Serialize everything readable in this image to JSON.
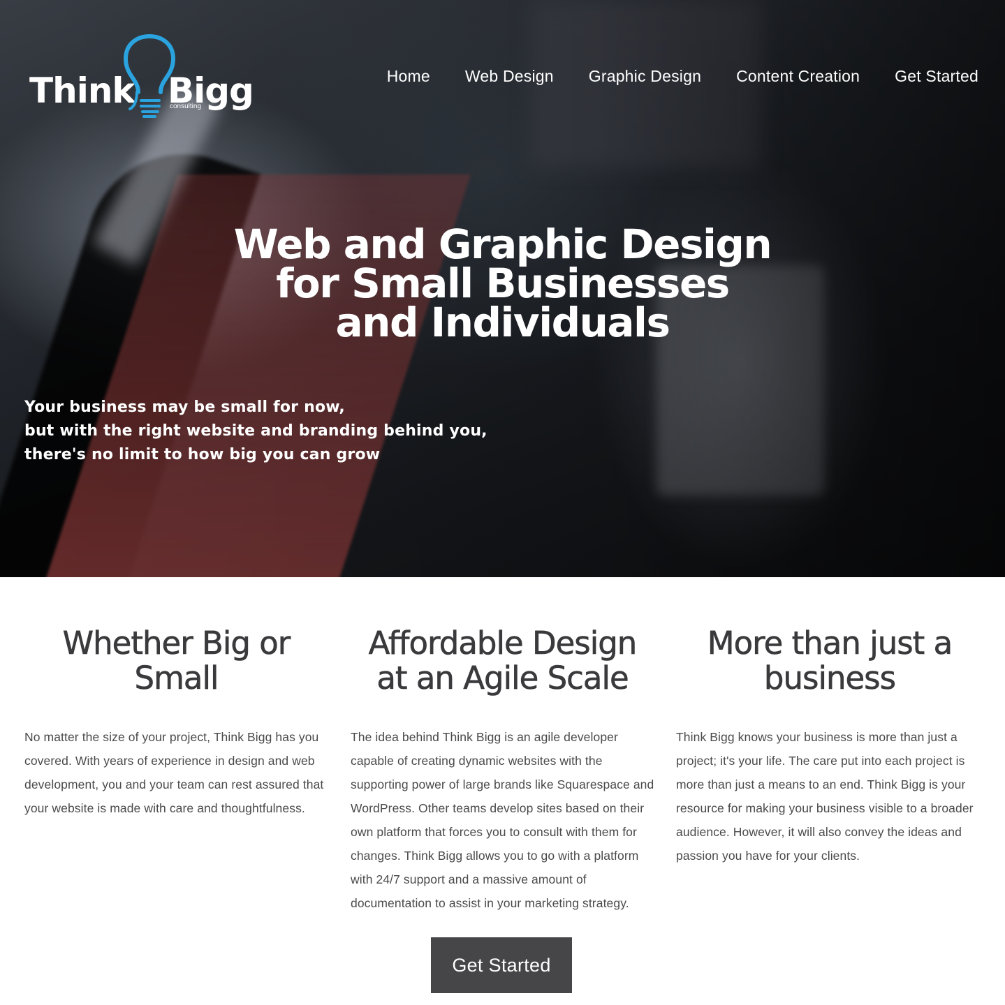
{
  "brand": {
    "name_left": "Think",
    "name_right": "Bigg",
    "sub": "consulting",
    "accent_color": "#2aa3df"
  },
  "nav": {
    "items": [
      {
        "label": "Home"
      },
      {
        "label": "Web Design"
      },
      {
        "label": "Graphic Design"
      },
      {
        "label": "Content Creation"
      },
      {
        "label": "Get Started"
      }
    ]
  },
  "hero": {
    "title_lines": [
      "Web and Graphic Design",
      "for Small Businesses",
      "and Individuals"
    ],
    "tagline_lines": [
      "Your business may be small for now,",
      "but with the right website and branding behind you,",
      "there's no limit to how big you can grow"
    ]
  },
  "features": [
    {
      "title": "Whether Big or Small",
      "body": "No matter the size of your project, Think Bigg has you covered. With years of experience in design and web development, you and your team can rest assured that your website is made with care and thoughtfulness."
    },
    {
      "title": "Affordable Design at an Agile Scale",
      "body": "The idea behind Think Bigg is an agile developer capable of creating dynamic websites with the supporting power of large brands like Squarespace and WordPress. Other teams develop sites based on their own platform that forces you to consult with them for changes. Think Bigg allows you to go with a platform with 24/7 support and a massive amount of documentation to assist in your marketing strategy."
    },
    {
      "title": "More than just a business",
      "body": "Think Bigg knows your business is more than just a project; it's your life. The care put into each project is more than just a means to an end. Think Bigg is your resource for making your business visible to a broader audience. However, it will also convey the ideas and passion you have for your clients."
    }
  ],
  "cta": {
    "label": "Get Started",
    "color": "#464648"
  }
}
